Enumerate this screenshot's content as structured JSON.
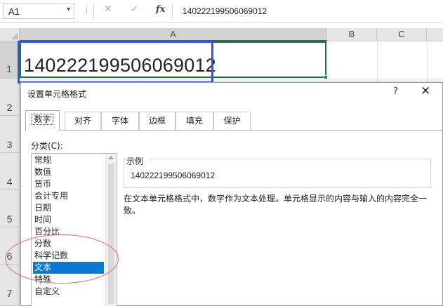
{
  "formula_bar": {
    "name_box": "A1",
    "dots": "⋮",
    "cancel_icon": "✕",
    "enter_icon": "✓",
    "fx": "fx",
    "content": "140222199506069012"
  },
  "sheet": {
    "columns": [
      "A",
      "B",
      "C"
    ],
    "rows": [
      "1",
      "2",
      "3",
      "4",
      "5",
      "6",
      "7"
    ],
    "cell_a1": "140222199506069012"
  },
  "dialog": {
    "title": "设置单元格格式",
    "help": "?",
    "close": "✕",
    "tabs": [
      "数字",
      "对齐",
      "字体",
      "边框",
      "填充",
      "保护"
    ],
    "category_label": "分类(C):",
    "categories": [
      "常规",
      "数值",
      "货币",
      "会计专用",
      "日期",
      "时间",
      "百分比",
      "分数",
      "科学记数",
      "文本",
      "特殊",
      "自定义"
    ],
    "selected_category": "文本",
    "sample_label": "示例",
    "sample_value": "140222199506069012",
    "description": "在文本单元格格式中，数字作为文本处理。单元格显示的内容与输入的内容完全一致。"
  },
  "colors": {
    "excel_green": "#217346",
    "highlight_box": "#3355e6",
    "annotation_ellipse": "#d96a6a",
    "selection_blue": "#0a78d7"
  }
}
